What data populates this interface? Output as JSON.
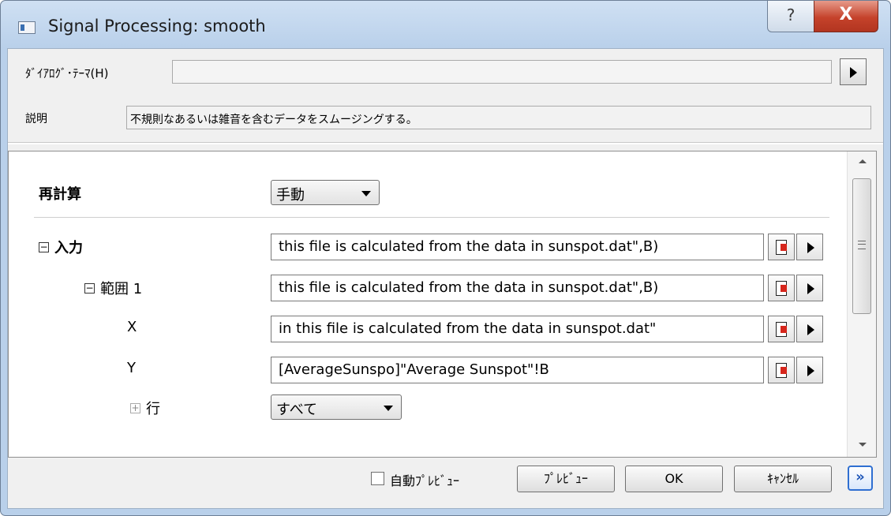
{
  "window": {
    "title": "Signal Processing: smooth",
    "help_label": "?",
    "close_label": "X"
  },
  "header": {
    "theme_label": "ﾀﾞｲｱﾛｸﾞ･ﾃｰﾏ(H)",
    "theme_value": "",
    "description_label": "説明",
    "description_value": "不規則なあるいは雑音を含むデータをスムージングする。"
  },
  "params": {
    "recalc_label": "再計算",
    "recalc_value": "手動",
    "input_label": "入力",
    "input_value": "this file is calculated from the data in sunspot.dat\",B)",
    "range_label": "範囲 1",
    "range_value": "this file is calculated from the data in sunspot.dat\",B)",
    "x_label": "X",
    "x_value": " in this file is calculated from the data in sunspot.dat\"",
    "y_label": "Y",
    "y_value": "[AverageSunspo]\"Average Sunspot\"!B",
    "rows_label": "行",
    "rows_value": "すべて"
  },
  "footer": {
    "auto_preview_label": "自動ﾌﾟﾚﾋﾞｭｰ",
    "auto_preview_checked": false,
    "preview_label": "ﾌﾟﾚﾋﾞｭｰ",
    "ok_label": "OK",
    "cancel_label": "ｷｬﾝｾﾙ",
    "expand_label": "»"
  },
  "colors": {
    "titlebar": "#b9d0ea",
    "close_button": "#c5422b",
    "expand_accent": "#2f6fd1"
  }
}
